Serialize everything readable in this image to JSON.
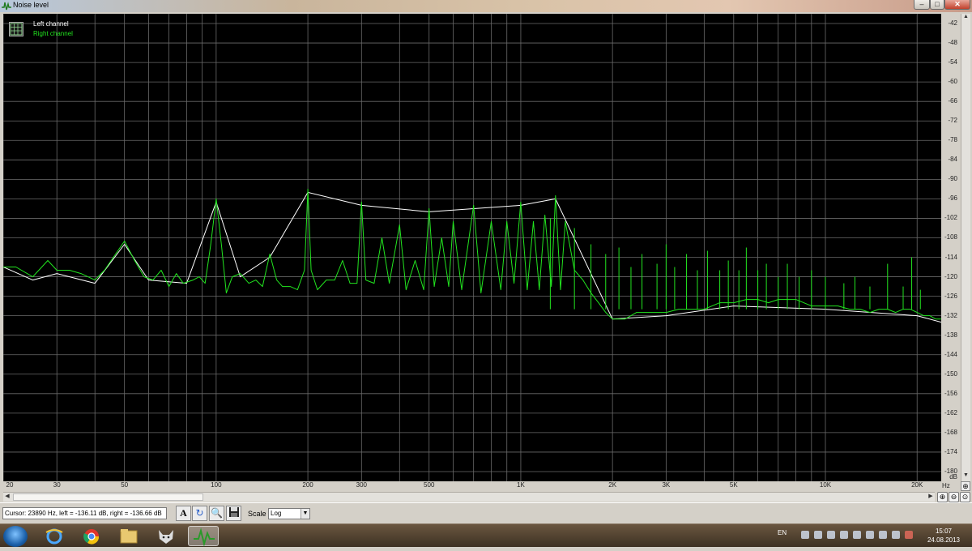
{
  "window": {
    "title": "Noise level",
    "min_glyph": "–",
    "max_glyph": "□",
    "close_glyph": "✕"
  },
  "legend": {
    "items": [
      {
        "label": "Left channel",
        "color": "#ffffff"
      },
      {
        "label": "Right channel",
        "color": "#22e51f"
      }
    ]
  },
  "y_axis": {
    "labels": [
      "-42",
      "-48",
      "-54",
      "-60",
      "-66",
      "-72",
      "-78",
      "-84",
      "-90",
      "-96",
      "-102",
      "-108",
      "-114",
      "-120",
      "-126",
      "-132",
      "-138",
      "-144",
      "-150",
      "-156",
      "-162",
      "-168",
      "-174",
      "-180"
    ],
    "unit": "dB"
  },
  "x_axis": {
    "labels": [
      "20",
      "30",
      "50",
      "100",
      "200",
      "300",
      "500",
      "1K",
      "2K",
      "3K",
      "5K",
      "10K",
      "20K"
    ],
    "unit": "Hz"
  },
  "chart_data": {
    "type": "line",
    "xlabel": "Hz",
    "ylabel": "dB",
    "x_scale": "log",
    "xlim": [
      20,
      24000
    ],
    "ylim": [
      -183,
      -39
    ],
    "grid": true,
    "legend_position": "top-left",
    "series": [
      {
        "name": "Right channel",
        "color": "#22e51f",
        "points": [
          [
            20,
            -117
          ],
          [
            22,
            -117
          ],
          [
            25,
            -120
          ],
          [
            28,
            -115
          ],
          [
            30,
            -118
          ],
          [
            33,
            -118
          ],
          [
            36,
            -119
          ],
          [
            40,
            -121
          ],
          [
            43,
            -118
          ],
          [
            46,
            -114
          ],
          [
            50,
            -109
          ],
          [
            54,
            -115
          ],
          [
            58,
            -120
          ],
          [
            62,
            -121
          ],
          [
            66,
            -118
          ],
          [
            70,
            -123
          ],
          [
            74,
            -119
          ],
          [
            78,
            -122
          ],
          [
            84,
            -121
          ],
          [
            88,
            -120
          ],
          [
            92,
            -122
          ],
          [
            96,
            -110
          ],
          [
            100,
            -96
          ],
          [
            104,
            -110
          ],
          [
            108,
            -125
          ],
          [
            113,
            -120
          ],
          [
            120,
            -119
          ],
          [
            128,
            -122
          ],
          [
            135,
            -121
          ],
          [
            142,
            -123
          ],
          [
            150,
            -113
          ],
          [
            158,
            -121
          ],
          [
            165,
            -123
          ],
          [
            175,
            -123
          ],
          [
            185,
            -124
          ],
          [
            195,
            -118
          ],
          [
            200,
            -93
          ],
          [
            205,
            -118
          ],
          [
            215,
            -124
          ],
          [
            230,
            -121
          ],
          [
            245,
            -121
          ],
          [
            260,
            -115
          ],
          [
            275,
            -122
          ],
          [
            290,
            -122
          ],
          [
            300,
            -97
          ],
          [
            310,
            -121
          ],
          [
            330,
            -122
          ],
          [
            350,
            -108
          ],
          [
            370,
            -122
          ],
          [
            400,
            -104
          ],
          [
            420,
            -124
          ],
          [
            450,
            -115
          ],
          [
            480,
            -124
          ],
          [
            500,
            -99
          ],
          [
            520,
            -123
          ],
          [
            550,
            -108
          ],
          [
            580,
            -123
          ],
          [
            600,
            -103
          ],
          [
            640,
            -124
          ],
          [
            700,
            -98
          ],
          [
            740,
            -125
          ],
          [
            800,
            -103
          ],
          [
            860,
            -124
          ],
          [
            900,
            -103
          ],
          [
            950,
            -122
          ],
          [
            1000,
            -97
          ],
          [
            1050,
            -124
          ],
          [
            1100,
            -103
          ],
          [
            1150,
            -124
          ],
          [
            1200,
            -101
          ],
          [
            1260,
            -123
          ],
          [
            1300,
            -95
          ],
          [
            1350,
            -124
          ],
          [
            1400,
            -103
          ],
          [
            1500,
            -118
          ],
          [
            1600,
            -121
          ],
          [
            1700,
            -125
          ],
          [
            1800,
            -128
          ],
          [
            1900,
            -131
          ],
          [
            2000,
            -133
          ],
          [
            2200,
            -133
          ],
          [
            2400,
            -131
          ],
          [
            2700,
            -131
          ],
          [
            3000,
            -131
          ],
          [
            3300,
            -130
          ],
          [
            3600,
            -130
          ],
          [
            4000,
            -130
          ],
          [
            4500,
            -128
          ],
          [
            5000,
            -128
          ],
          [
            5500,
            -127
          ],
          [
            6000,
            -127
          ],
          [
            6500,
            -128
          ],
          [
            7000,
            -127
          ],
          [
            8000,
            -127
          ],
          [
            9000,
            -129
          ],
          [
            10000,
            -129
          ],
          [
            11000,
            -129
          ],
          [
            12000,
            -130
          ],
          [
            13000,
            -130
          ],
          [
            14000,
            -131
          ],
          [
            15000,
            -130
          ],
          [
            16000,
            -130
          ],
          [
            17000,
            -131
          ],
          [
            18000,
            -130
          ],
          [
            19000,
            -130
          ],
          [
            20000,
            -131
          ],
          [
            21000,
            -132
          ],
          [
            22000,
            -132
          ],
          [
            23000,
            -133
          ],
          [
            24000,
            -133
          ]
        ],
        "peaks": [
          [
            1250,
            -102
          ],
          [
            1500,
            -105
          ],
          [
            1700,
            -110
          ],
          [
            1900,
            -113
          ],
          [
            2100,
            -111
          ],
          [
            2300,
            -117
          ],
          [
            2500,
            -113
          ],
          [
            2800,
            -116
          ],
          [
            3000,
            -110
          ],
          [
            3200,
            -117
          ],
          [
            3500,
            -113
          ],
          [
            3800,
            -118
          ],
          [
            4100,
            -112
          ],
          [
            4500,
            -118
          ],
          [
            4800,
            -115
          ],
          [
            5200,
            -118
          ],
          [
            5500,
            -111
          ],
          [
            6000,
            -118
          ],
          [
            6400,
            -116
          ],
          [
            7000,
            -120
          ],
          [
            7500,
            -116
          ],
          [
            8200,
            -120
          ],
          [
            9000,
            -118
          ],
          [
            10000,
            -120
          ],
          [
            11500,
            -122
          ],
          [
            12500,
            -120
          ],
          [
            14000,
            -123
          ],
          [
            16000,
            -116
          ],
          [
            18000,
            -123
          ],
          [
            19200,
            -114
          ],
          [
            20500,
            -124
          ]
        ]
      },
      {
        "name": "Left channel",
        "color": "#ffffff",
        "points": [
          [
            20,
            -117
          ],
          [
            25,
            -121
          ],
          [
            30,
            -119
          ],
          [
            40,
            -122
          ],
          [
            50,
            -110
          ],
          [
            60,
            -121
          ],
          [
            80,
            -122
          ],
          [
            100,
            -97
          ],
          [
            120,
            -120
          ],
          [
            150,
            -114
          ],
          [
            200,
            -94
          ],
          [
            300,
            -98
          ],
          [
            500,
            -100
          ],
          [
            1000,
            -98
          ],
          [
            1300,
            -96
          ],
          [
            2000,
            -133
          ],
          [
            3000,
            -132
          ],
          [
            5000,
            -129
          ],
          [
            10000,
            -130
          ],
          [
            20000,
            -132
          ],
          [
            24000,
            -134
          ]
        ]
      }
    ]
  },
  "status": {
    "cursor_text": "Cursor:  23890 Hz,  left = -136.11 dB,  right = -136.66 dB",
    "scale_label": "Scale",
    "scale_value": "Log"
  },
  "taskbar": {
    "language": "EN",
    "time": "15:07",
    "date": "24.08.2013"
  }
}
